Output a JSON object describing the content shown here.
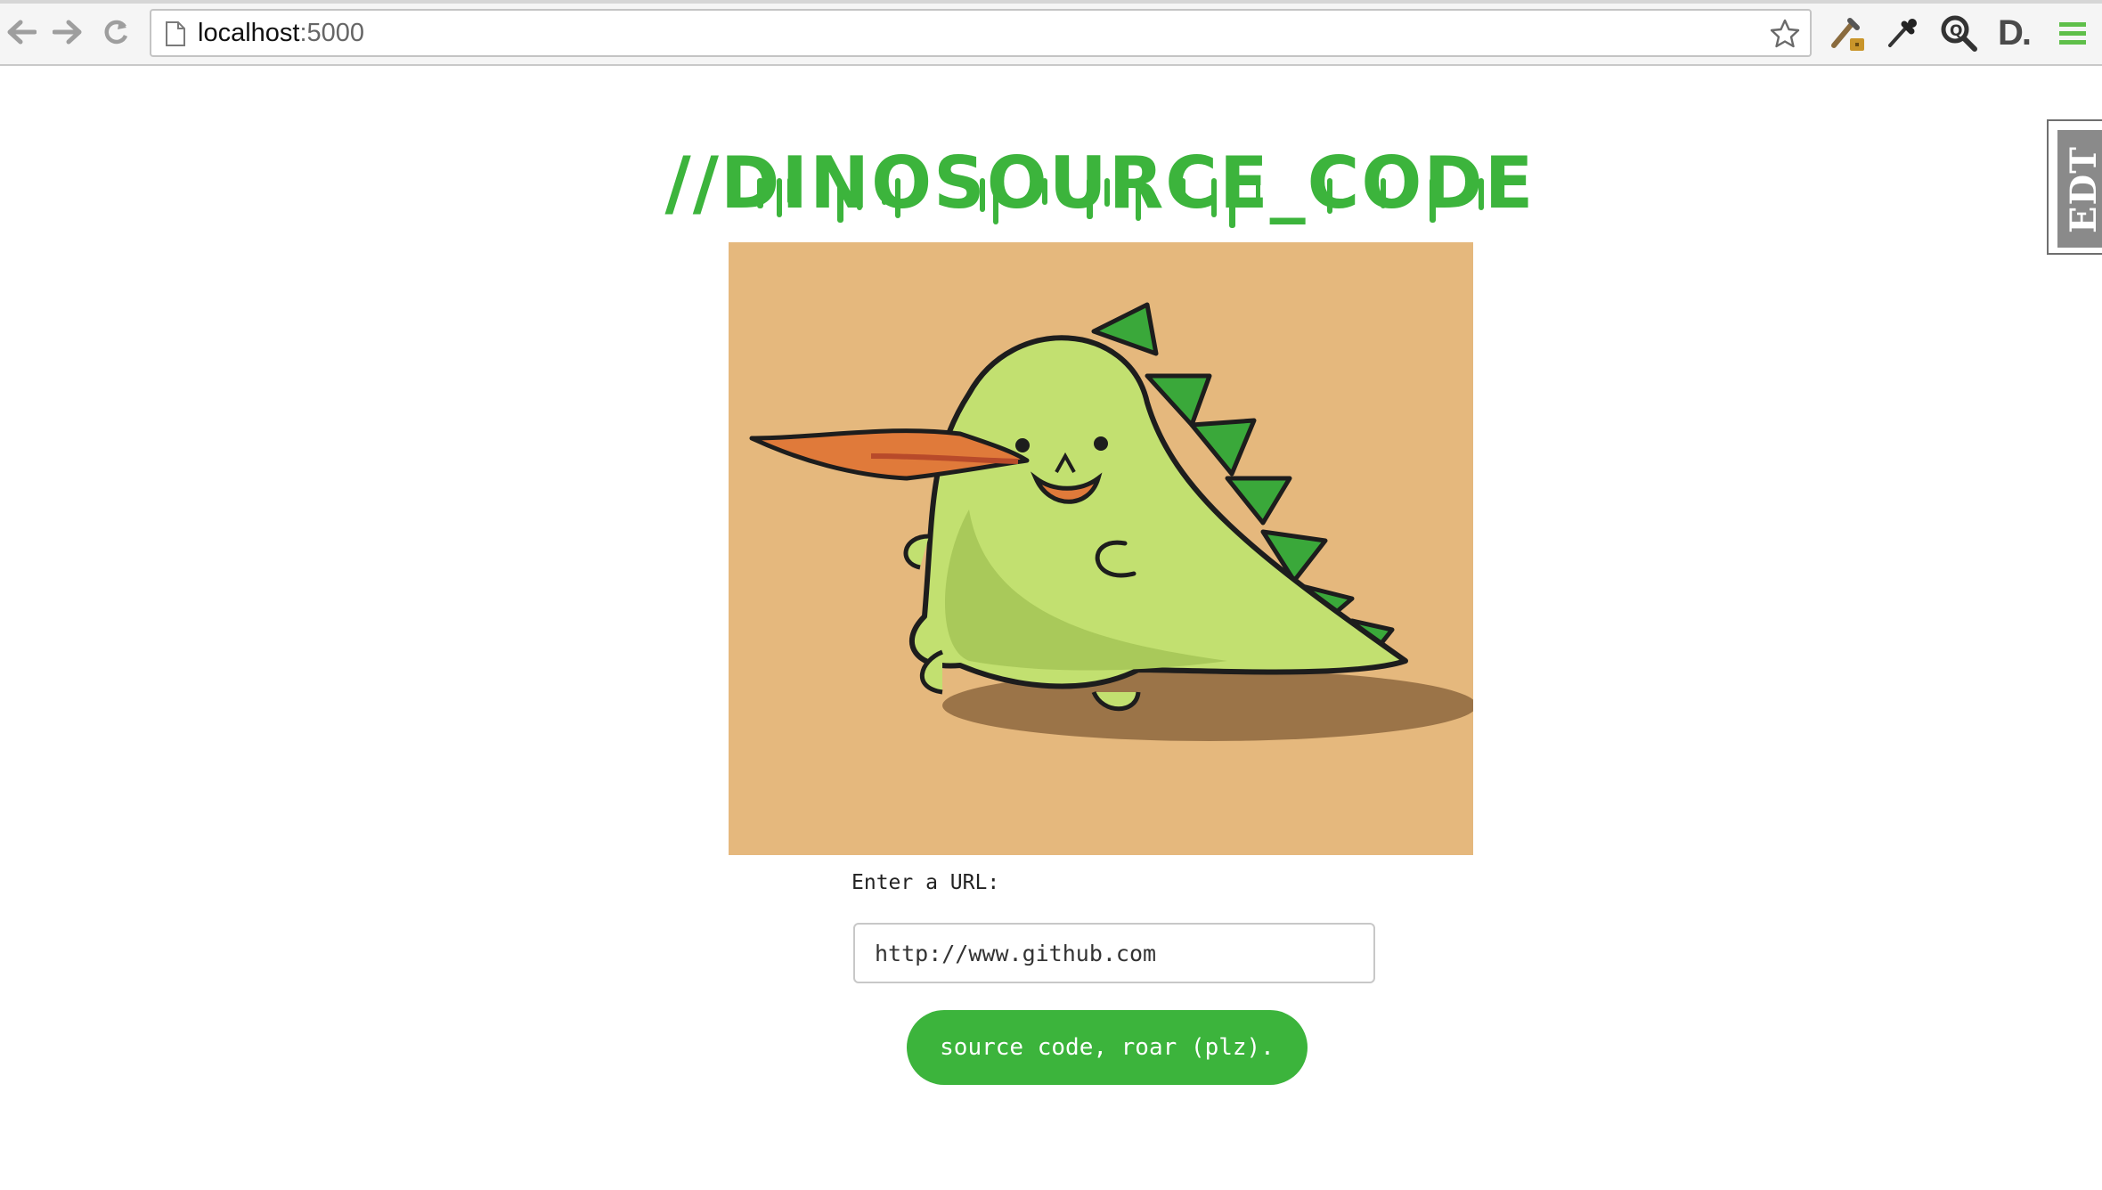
{
  "browser": {
    "address": {
      "host": "localhost",
      "port": ":5000"
    },
    "icons": {
      "back": "arrow-left-icon",
      "forward": "arrow-right-icon",
      "reload": "reload-icon",
      "page": "page-icon",
      "star": "star-icon",
      "extensions": [
        "eyedropper-extension-icon",
        "color-picker-icon",
        "magnifier-extension-icon",
        "d-extension-icon",
        "hamburger-menu-icon"
      ]
    },
    "extension_d_label": "D."
  },
  "page": {
    "title": "//DINOSOURCE_CODE",
    "image": {
      "description_icon": "dinosaur-illustration"
    },
    "form": {
      "label": "Enter a URL:",
      "input_value": "http://www.github.com",
      "button_label": "source code, roar (plz)."
    },
    "side_tab": {
      "label": "EDT"
    }
  },
  "colors": {
    "accent": "#3cb43c",
    "image_background": "#e5b87d",
    "dino_body": "#c2e070",
    "dino_spikes": "#3aa83a",
    "fire": "#e07a3a"
  }
}
